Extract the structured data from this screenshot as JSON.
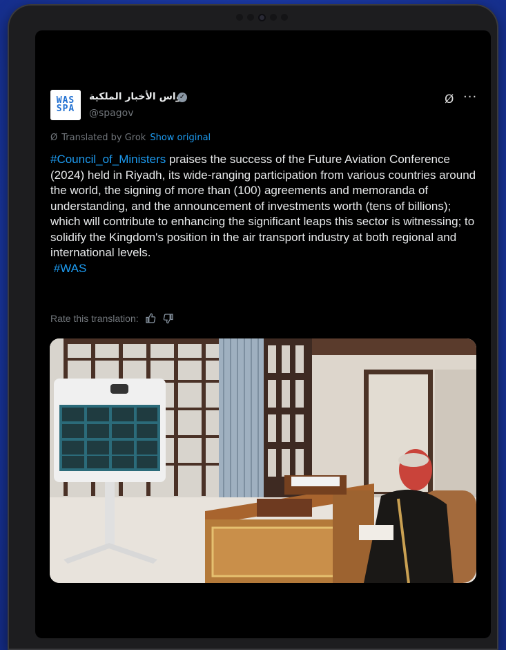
{
  "post": {
    "display_name": "واس الأخبار الملكية",
    "handle": "@spagov",
    "avatar_logo_top": "WAS",
    "avatar_logo_bottom": "SPA",
    "translated_by": "Translated by Grok",
    "show_original": "Show original",
    "hashtag_main": "#Council_of_Ministers",
    "body": " praises the success of the Future Aviation Conference (2024) held in Riyadh, its wide-ranging participation from various countries around the world, the signing of more than (100) agreements and memoranda of understanding, and the announcement of investments worth (tens of billions); which will contribute to enhancing the significant leaps this sector is witnessing; to solidify the Kingdom's position in the air transport industry at both regional and international levels.",
    "hashtag_was": "#WAS",
    "rate_label": "Rate this translation:",
    "more_label": "···"
  },
  "icons": {
    "verified": "verified-badge-icon",
    "grok": "grok-icon",
    "more": "more-options-icon",
    "thumbs_up": "thumbs-up-icon",
    "thumbs_down": "thumbs-down-icon"
  },
  "colors": {
    "background": "#000000",
    "accent": "#1d9bf0",
    "text": "#e7e9ea",
    "muted": "#71767b"
  }
}
